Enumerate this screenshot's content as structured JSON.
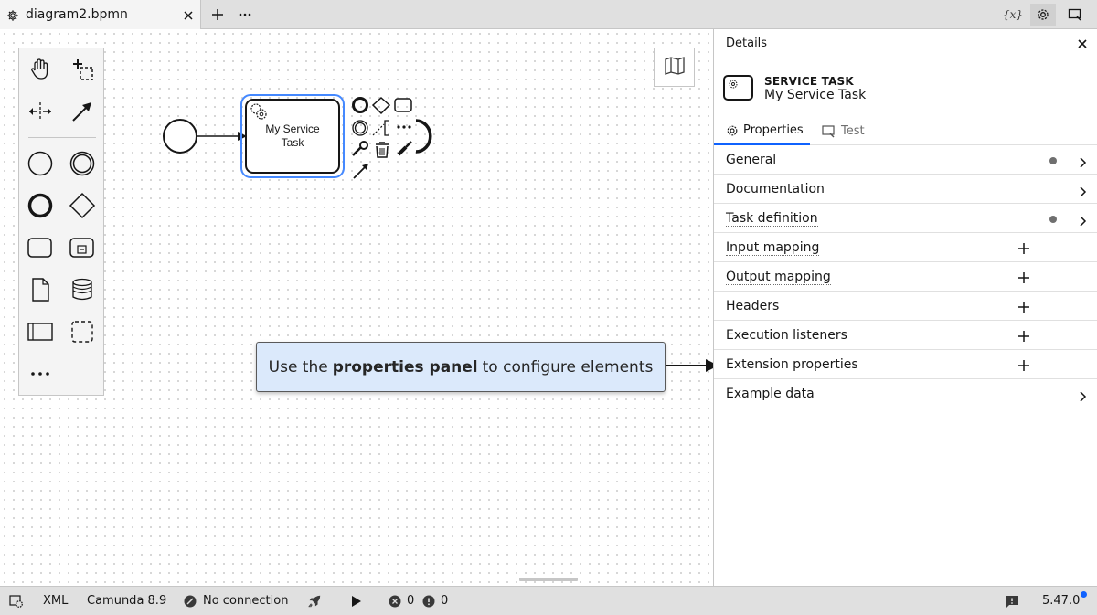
{
  "tabbar": {
    "tab_label": "diagram2.bpmn",
    "variables_icon_text": "{x}",
    "icons": [
      "gear-icon",
      "close-icon",
      "plus-icon",
      "overflow-menu-icon",
      "variables-icon",
      "settings-icon",
      "run-panel-icon"
    ]
  },
  "canvas": {
    "palette_tools": [
      "hand-tool",
      "lasso-tool",
      "space-tool",
      "connect-tool",
      "start-event",
      "intermediate-event",
      "end-event",
      "gateway",
      "task",
      "subprocess",
      "data-object",
      "data-store",
      "pool",
      "group",
      "more"
    ],
    "task_label_line1": "My Service",
    "task_label_line2": "Task",
    "callout": {
      "prefix": "Use the",
      "bold": "properties panel",
      "suffix": "to configure elements"
    }
  },
  "panel": {
    "title": "Details",
    "element_type": "SERVICE TASK",
    "element_name": "My Service Task",
    "tabs": [
      {
        "label": "Properties",
        "active": true
      },
      {
        "label": "Test",
        "active": false
      }
    ],
    "groups": [
      {
        "label": "General",
        "dotted": false,
        "indicator": "dot",
        "action": "chevron"
      },
      {
        "label": "Documentation",
        "dotted": false,
        "indicator": "",
        "action": "chevron"
      },
      {
        "label": "Task definition",
        "dotted": true,
        "indicator": "dot",
        "action": "chevron"
      },
      {
        "label": "Input mapping",
        "dotted": true,
        "indicator": "",
        "action": "plus"
      },
      {
        "label": "Output mapping",
        "dotted": true,
        "indicator": "",
        "action": "plus"
      },
      {
        "label": "Headers",
        "dotted": false,
        "indicator": "",
        "action": "plus"
      },
      {
        "label": "Execution listeners",
        "dotted": false,
        "indicator": "",
        "action": "plus"
      },
      {
        "label": "Extension properties",
        "dotted": false,
        "indicator": "",
        "action": "plus"
      },
      {
        "label": "Example data",
        "dotted": false,
        "indicator": "",
        "action": "chevron"
      }
    ]
  },
  "statusbar": {
    "xml": "XML",
    "engine": "Camunda 8.9",
    "connection": "No connection",
    "errors": "0",
    "warnings": "0",
    "version": "5.47.0"
  },
  "colors": {
    "accent": "#0f62fe",
    "selection": "#4589ff",
    "callout_bg": "#dbe9fb",
    "chrome_bg": "#e0e0e0"
  }
}
